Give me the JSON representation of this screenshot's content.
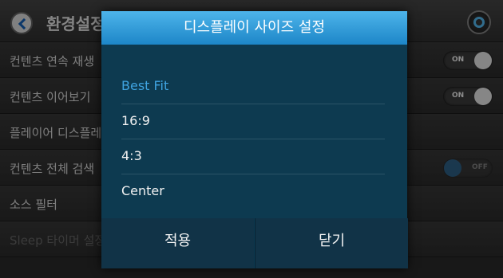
{
  "header": {
    "title": "환경설정"
  },
  "settings": {
    "rows": [
      {
        "label": "컨텐츠 연속 재생",
        "toggle": "ON"
      },
      {
        "label": "컨텐츠 이어보기",
        "toggle": "ON"
      },
      {
        "label": "플레이어 디스플레이",
        "toggle": null
      },
      {
        "label": "컨텐츠 전체 검색",
        "toggle": "OFF"
      },
      {
        "label": "소스 필터",
        "toggle": null
      },
      {
        "label": "Sleep 타이머 설정",
        "toggle": null
      }
    ]
  },
  "dialog": {
    "title": "디스플레이 사이즈 설정",
    "options": [
      {
        "label": "Best Fit",
        "selected": true
      },
      {
        "label": "16:9",
        "selected": false
      },
      {
        "label": "4:3",
        "selected": false
      },
      {
        "label": "Center",
        "selected": false
      }
    ],
    "apply_label": "적용",
    "close_label": "닫기"
  },
  "colors": {
    "accent": "#3fa3e0",
    "dialog_bg": "#0d3a50",
    "title_bar": "#2f9bd8"
  },
  "icons": {
    "back": "back-arrow-icon",
    "settings": "gear-icon"
  }
}
